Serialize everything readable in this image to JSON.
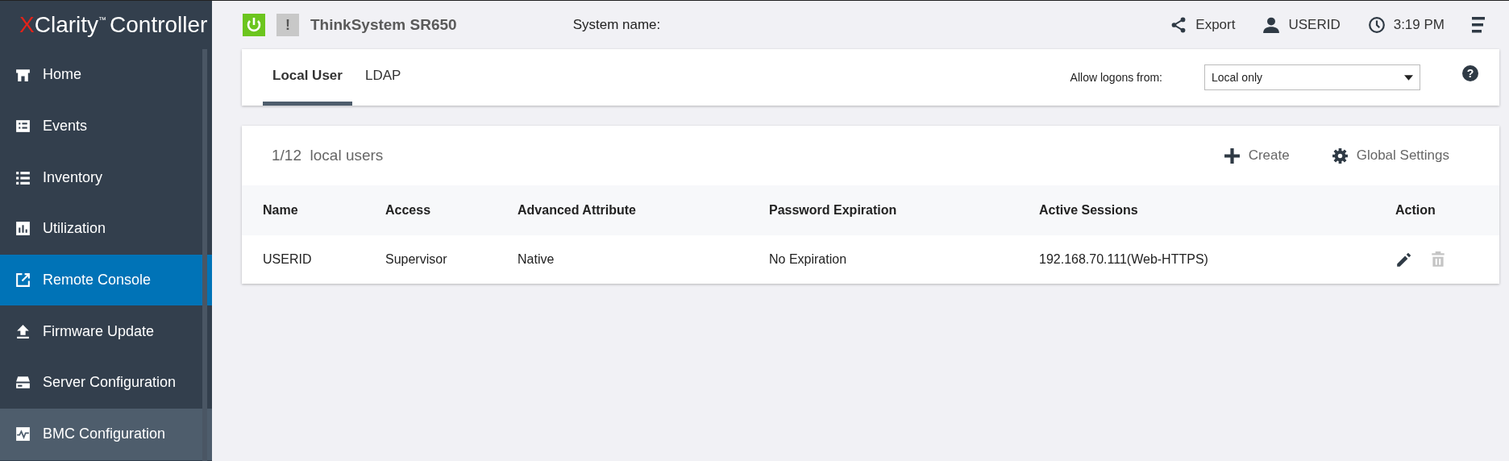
{
  "logo": {
    "mark": "X",
    "name": "Clarity",
    "tm": "™",
    "suffix": "Controller"
  },
  "sidebar": {
    "items": [
      {
        "label": "Home",
        "kind": "home",
        "selected": false,
        "hovered": false
      },
      {
        "label": "Events",
        "kind": "events",
        "selected": false,
        "hovered": false
      },
      {
        "label": "Inventory",
        "kind": "list",
        "selected": false,
        "hovered": false
      },
      {
        "label": "Utilization",
        "kind": "chart",
        "selected": false,
        "hovered": false
      },
      {
        "label": "Remote Console",
        "kind": "external",
        "selected": true,
        "hovered": false
      },
      {
        "label": "Firmware Update",
        "kind": "upload",
        "selected": false,
        "hovered": false
      },
      {
        "label": "Server Configuration",
        "kind": "server",
        "selected": false,
        "hovered": false
      },
      {
        "label": "BMC Configuration",
        "kind": "pulse",
        "selected": false,
        "hovered": true
      }
    ]
  },
  "header": {
    "warning_mark": "!",
    "system": "ThinkSystem SR650",
    "system_name_label": "System name:",
    "export": "Export",
    "user": "USERID",
    "time": "3:19 PM"
  },
  "tabs": [
    {
      "label": "Local User",
      "selected": true
    },
    {
      "label": "LDAP",
      "selected": false
    }
  ],
  "allow_logons": {
    "label": "Allow logons from:",
    "value": "Local only"
  },
  "help_mark": "?",
  "users": {
    "count": "1/12",
    "count_label": "local users",
    "create": "Create",
    "global_settings": "Global Settings",
    "columns": [
      "Name",
      "Access",
      "Advanced Attribute",
      "Password Expiration",
      "Active Sessions",
      "Action"
    ],
    "rows": [
      {
        "cells": [
          "USERID",
          "Supervisor",
          "Native",
          "No Expiration",
          "192.168.70.111(Web-HTTPS)"
        ],
        "actions": [
          {
            "kind": "edit",
            "disabled": false
          },
          {
            "kind": "delete",
            "disabled": true
          }
        ]
      }
    ]
  }
}
